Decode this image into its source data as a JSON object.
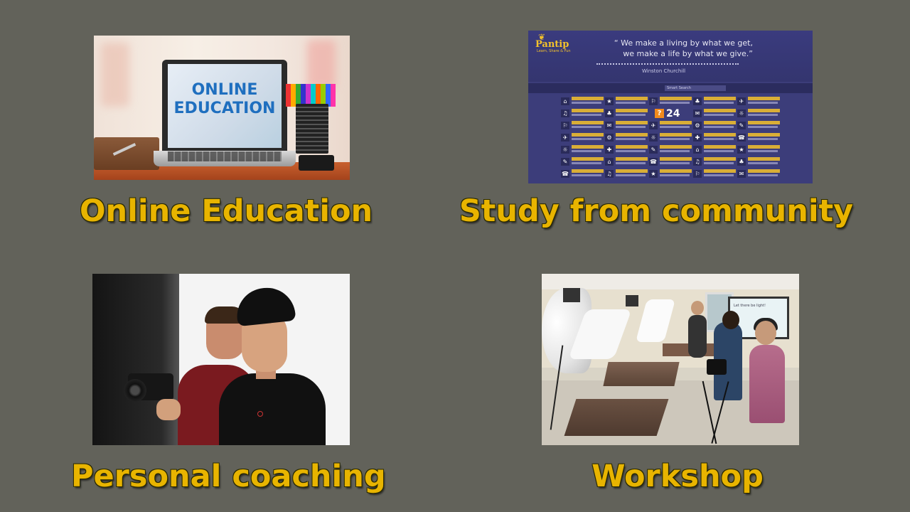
{
  "tiles": [
    {
      "caption": "Online Education",
      "image": {
        "screen_text_line1": "ONLINE",
        "screen_text_line2": "EDUCATION"
      }
    },
    {
      "caption": "Study from community",
      "image": {
        "logo": "Pantip",
        "logo_sub": "Learn, Share & Fun",
        "quote_line1": "“ We make a living by what we get,",
        "quote_line2": "we make a life by what we give.”",
        "quote_author": "Winston Churchill",
        "search_placeholder": "Smart Search",
        "date_day": "24"
      }
    },
    {
      "caption": "Personal coaching",
      "image": {}
    },
    {
      "caption": "Workshop",
      "image": {
        "screen_text": "Let there be light!"
      }
    }
  ],
  "colors": {
    "background": "#62625a",
    "caption_fill": "#e8b400",
    "caption_outline": "#2a2a00",
    "pantip_bg": "#3c3d7a",
    "pantip_gold": "#f4c22b"
  }
}
